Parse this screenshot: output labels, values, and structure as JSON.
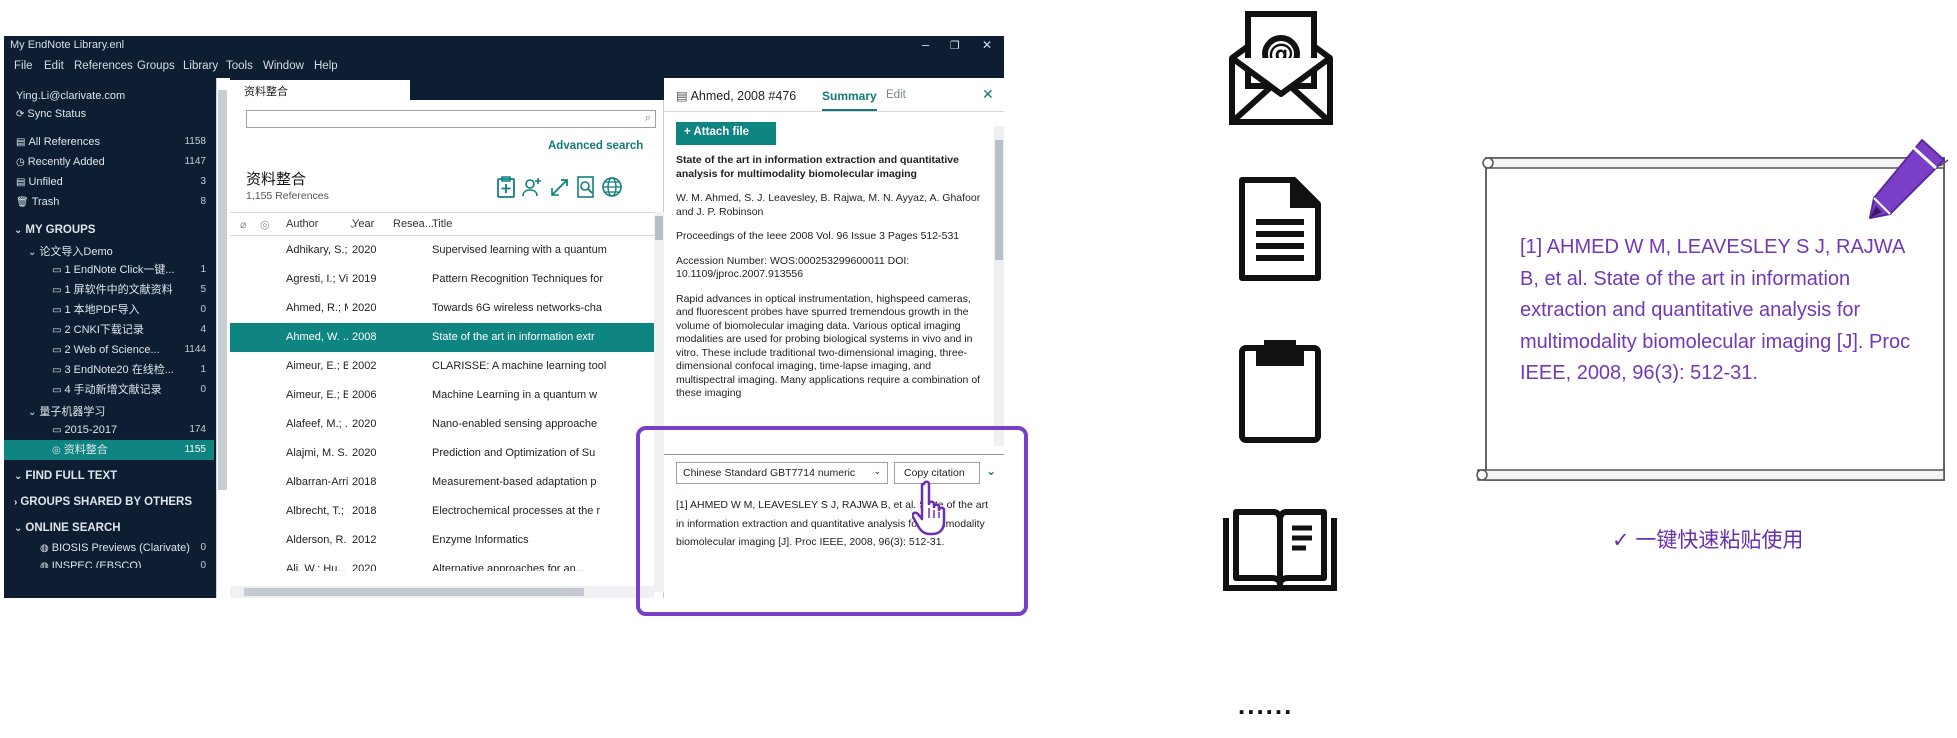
{
  "window": {
    "title": "My EndNote Library.enl",
    "controls": [
      "–",
      "❐",
      "✕"
    ]
  },
  "menu": [
    "File",
    "Edit",
    "References",
    "Groups",
    "Library",
    "Tools",
    "Window",
    "Help"
  ],
  "sidebar": {
    "account": "Ying.Li@clarivate.com",
    "sync": "Sync Status",
    "items": [
      {
        "label": "All References",
        "count": "1158"
      },
      {
        "label": "Recently Added",
        "count": "1147"
      },
      {
        "label": "Unfiled",
        "count": "3"
      },
      {
        "label": "Trash",
        "count": "8"
      }
    ],
    "my_groups": "MY GROUPS",
    "group_set_1": "论文导入Demo",
    "groups_1": [
      {
        "label": "1 EndNote Click一键...",
        "count": "1"
      },
      {
        "label": "1 屏软件中的文献资料",
        "count": "5"
      },
      {
        "label": "1 本地PDF导入",
        "count": "0"
      },
      {
        "label": "2 CNKI下载记录",
        "count": "4"
      },
      {
        "label": "2 Web of Science...",
        "count": "1144"
      },
      {
        "label": "3 EndNote20 在线检...",
        "count": "1"
      },
      {
        "label": "4 手动新增文献记录",
        "count": "0"
      }
    ],
    "group_set_2": "量子机器学习",
    "groups_2": [
      {
        "label": "2015-2017",
        "count": "174"
      },
      {
        "label": "资料整合",
        "count": "1155"
      }
    ],
    "find_full_text": "FIND FULL TEXT",
    "shared": "GROUPS SHARED BY OTHERS",
    "online_search": "ONLINE SEARCH",
    "online_items": [
      {
        "label": "BIOSIS Previews (Clarivate)",
        "count": "0"
      },
      {
        "label": "INSPEC (EBSCO)",
        "count": "0"
      }
    ]
  },
  "library": {
    "tab": "资料整合",
    "advanced_search": "Advanced search",
    "title": "资料整合",
    "count": "1,155 References",
    "columns": [
      "Author",
      "Year",
      "Resea...",
      "Title"
    ],
    "rows": [
      {
        "author": "Adhikary, S.; ...",
        "year": "2020",
        "title": "Supervised learning with a quantum"
      },
      {
        "author": "Agresti, I.; Vi...",
        "year": "2019",
        "title": "Pattern Recognition Techniques for"
      },
      {
        "author": "Ahmed, R.; M...",
        "year": "2020",
        "title": "Towards 6G wireless networks-cha"
      },
      {
        "author": "Ahmed, W. ...",
        "year": "2008",
        "title": "State of the art in information extr"
      },
      {
        "author": "Aimeur, E.; Br...",
        "year": "2002",
        "title": "CLARISSE: A machine learning tool"
      },
      {
        "author": "Aimeur, E.; Br...",
        "year": "2006",
        "title": "Machine Learning in a quantum w"
      },
      {
        "author": "Alafeef, M.; ...",
        "year": "2020",
        "title": "Nano-enabled sensing approache"
      },
      {
        "author": "Alajmi, M. S.;...",
        "year": "2020",
        "title": "Prediction and Optimization of Su"
      },
      {
        "author": "Albarran-Arri...",
        "year": "2018",
        "title": "Measurement-based adaptation p"
      },
      {
        "author": "Albrecht, T.; ...",
        "year": "2018",
        "title": "Electrochemical processes at the r"
      },
      {
        "author": "Alderson, R. ...",
        "year": "2012",
        "title": "Enzyme Informatics"
      },
      {
        "author": "Ali, W.; Hu...",
        "year": "2020",
        "title": "Alternative approaches for an..."
      }
    ]
  },
  "summary": {
    "title": "Ahmed, 2008 #476",
    "tab_summary": "Summary",
    "tab_edit": "Edit",
    "attach": "+ Attach file",
    "ref_title": "State of the art in information extraction and quantitative analysis for multimodality biomolecular imaging",
    "authors": "W. M. Ahmed, S. J. Leavesley, B. Rajwa, M. N. Ayyaz, A. Ghafoor and J. P. Robinson",
    "source": "Proceedings of the Ieee 2008 Vol. 96 Issue 3 Pages 512-531",
    "accession": "Accession Number: WOS:000253299600011 DOI: 10.1109/jproc.2007.913556",
    "abstract": "Rapid advances in optical instrumentation, highspeed cameras, and fluorescent probes have spurred tremendous growth in the volume of biomolecular imaging data. Various optical imaging modalities are used for probing biological systems in vivo and in vitro. These include traditional two-dimensional imaging, three-dimensional confocal imaging, time-lapse imaging, and multispectral imaging. Many applications require a combination of these imaging",
    "style": "Chinese Standard GBT7714 numeric",
    "copy_citation": "Copy citation",
    "citation": "[1]     AHMED W M, LEAVESLEY S J, RAJWA B, et al. State of the art in information extraction and quantitative analysis for multimodality biomolecular imaging [J]. Proc IEEE, 2008, 96(3): 512-31."
  },
  "icons": [
    "email-icon",
    "document-icon",
    "clipboard-icon",
    "book-icon"
  ],
  "ellipsis": "......",
  "card": {
    "reference": "[1]  AHMED W M, LEAVESLEY S J, RAJWA B, et al. State of the art in information extraction and quantitative analysis for multimodality biomolecular imaging [J]. Proc IEEE, 2008, 96(3): 512-31.",
    "tagline": "✓ 一键快速粘贴使用"
  },
  "colors": {
    "navy": "#0d1e33",
    "teal": "#0f8582",
    "purple": "#7b3fc7"
  }
}
